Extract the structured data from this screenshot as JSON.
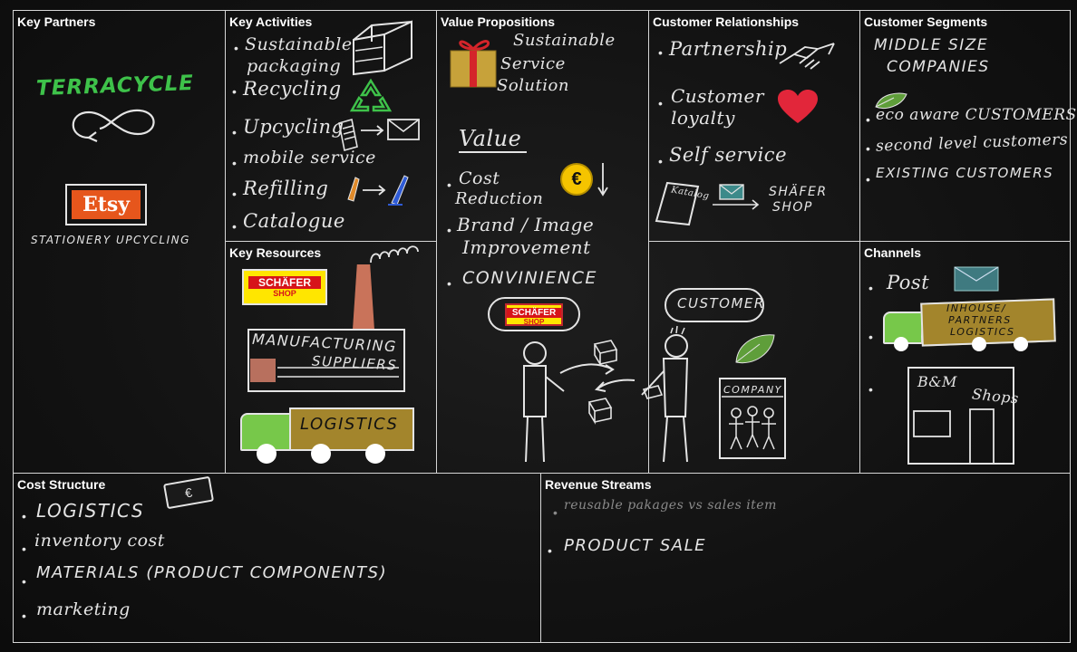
{
  "sections": {
    "key_partners": "Key Partners",
    "key_activities": "Key Activities",
    "value_propositions": "Value Propositions",
    "customer_relationships": "Customer Relationships",
    "customer_segments": "Customer Segments",
    "key_resources": "Key Resources",
    "channels": "Channels",
    "cost_structure": "Cost Structure",
    "revenue_streams": "Revenue Streams"
  },
  "key_partners": {
    "terracycle": "TERRACYCLE",
    "etsy": "Etsy",
    "stationery": "STATIONERY UPCYCLING"
  },
  "key_activities": [
    "Sustainable",
    "packaging",
    "Recycling",
    "Upcycling",
    "mobile service",
    "Refilling",
    "Catalogue"
  ],
  "key_resources": {
    "schafer_1": "SCHÄFER",
    "schafer_2": "SHOP",
    "manufacturing": "MANUFACTURING",
    "suppliers": "SUPPLIERS",
    "logistics": "LOGISTICS"
  },
  "value_propositions": {
    "gift": [
      "Sustainable",
      "Service",
      "Solution"
    ],
    "value_heading": "Value",
    "items": [
      "Cost",
      "Reduction",
      "Brand / Image",
      "Improvement",
      "CONVINIENCE"
    ],
    "euro": "€",
    "schafer_1": "SCHÄFER",
    "schafer_2": "SHOP",
    "customer": "CUSTOMER",
    "company": "COMPANY"
  },
  "customer_relationships": {
    "items": [
      "Partnership",
      "Customer",
      "loyalty",
      "Self service"
    ],
    "catalog": "Katalog",
    "schafer_shop": [
      "SHÄFER",
      "SHOP"
    ]
  },
  "customer_segments": {
    "items": [
      "MIDDLE SIZE",
      "COMPANIES",
      "eco aware CUSTOMERS",
      "second level customers",
      "EXISTING CUSTOMERS"
    ]
  },
  "channels": {
    "post": "Post",
    "truck": [
      "INHOUSE/",
      "PARTNERS",
      "LOGISTICS"
    ],
    "store": [
      "B&M",
      "Shops"
    ]
  },
  "cost_structure": {
    "items": [
      "LOGISTICS",
      "inventory cost",
      "MATERIALS (PRODUCT COMPONENTS)",
      "marketing"
    ],
    "money": "€"
  },
  "revenue_streams": {
    "items": [
      "reusable pakages vs sales item",
      "PRODUCT SALE"
    ]
  },
  "colors": {
    "board": "#121212",
    "line": "#d6d6d6",
    "chalk": "#e4e4e4",
    "green_text": "#3ec24a",
    "etsy_orange": "#e6561c",
    "truck_green": "#77c84a",
    "truck_gold": "#a3852c",
    "gift_gold": "#c7a23a",
    "ribbon_red": "#d4242a",
    "heart_red": "#e2263a",
    "euro_yellow": "#f5c400",
    "schafer_yellow": "#ffe600",
    "schafer_red": "#d7141a",
    "chimney": "#c9735a"
  }
}
